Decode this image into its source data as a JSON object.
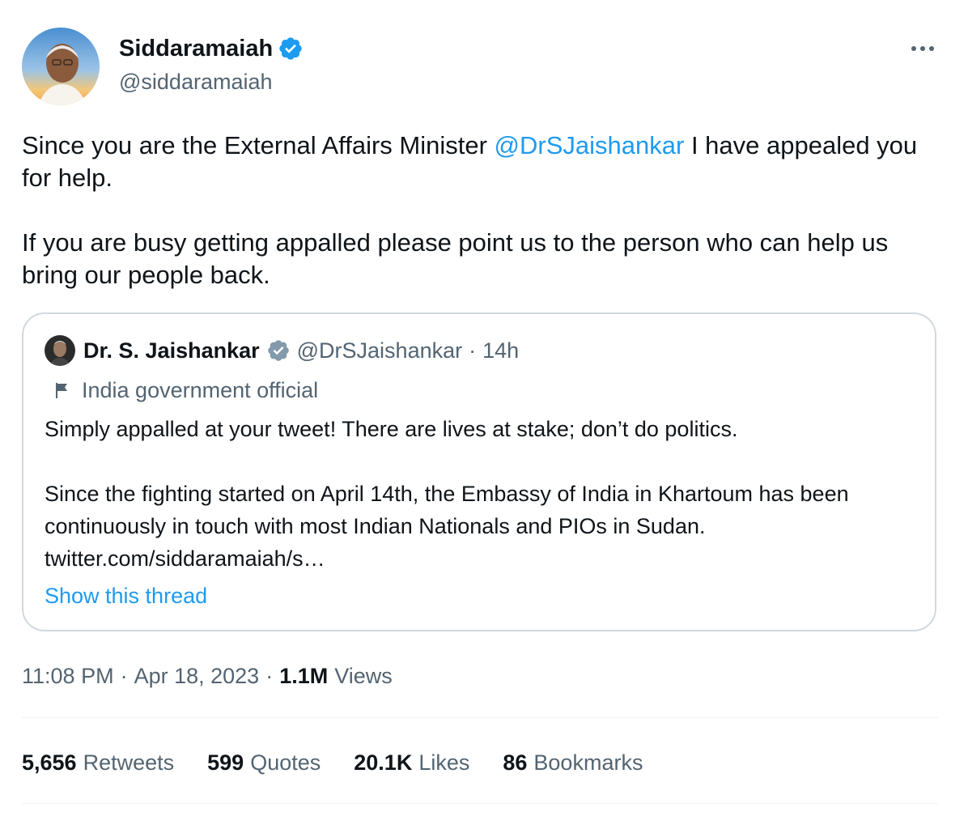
{
  "author": {
    "name": "Siddaramaiah",
    "handle": "@siddaramaiah",
    "verified_color": "#1d9bf0"
  },
  "tweet": {
    "line1_before": "Since you are the External Affairs Minister ",
    "mention": "@DrSJaishankar",
    "line1_after": " I have appealed you for help.",
    "paragraph2": "If you are busy getting appalled please point us to the person who can help us bring our people back."
  },
  "quote": {
    "name": "Dr. S. Jaishankar",
    "handle": "@DrSJaishankar",
    "separator": "·",
    "time": "14h",
    "label": "India government official",
    "badge_color": "#829aab",
    "paragraph1": "Simply appalled at your tweet! There are lives at stake; don’t do politics.",
    "paragraph2": "Since the fighting started on April 14th, the Embassy of India in Khartoum has been continuously in touch with most Indian Nationals and PIOs in Sudan.",
    "link": "twitter.com/siddaramaiah/s…",
    "show_thread": "Show this thread"
  },
  "meta": {
    "time": "11:08 PM",
    "dot1": "·",
    "date": "Apr 18, 2023",
    "dot2": "·",
    "views_count": "1.1M",
    "views_label": "Views"
  },
  "stats": [
    {
      "count": "5,656",
      "label": "Retweets"
    },
    {
      "count": "599",
      "label": "Quotes"
    },
    {
      "count": "20.1K",
      "label": "Likes"
    },
    {
      "count": "86",
      "label": "Bookmarks"
    }
  ],
  "icons": {
    "verified": "verified-badge-icon",
    "more": "more-dots-icon",
    "flag": "flag-icon"
  },
  "colors": {
    "link": "#1d9bf0",
    "secondary_text": "#536471",
    "border": "#cfd9de"
  }
}
